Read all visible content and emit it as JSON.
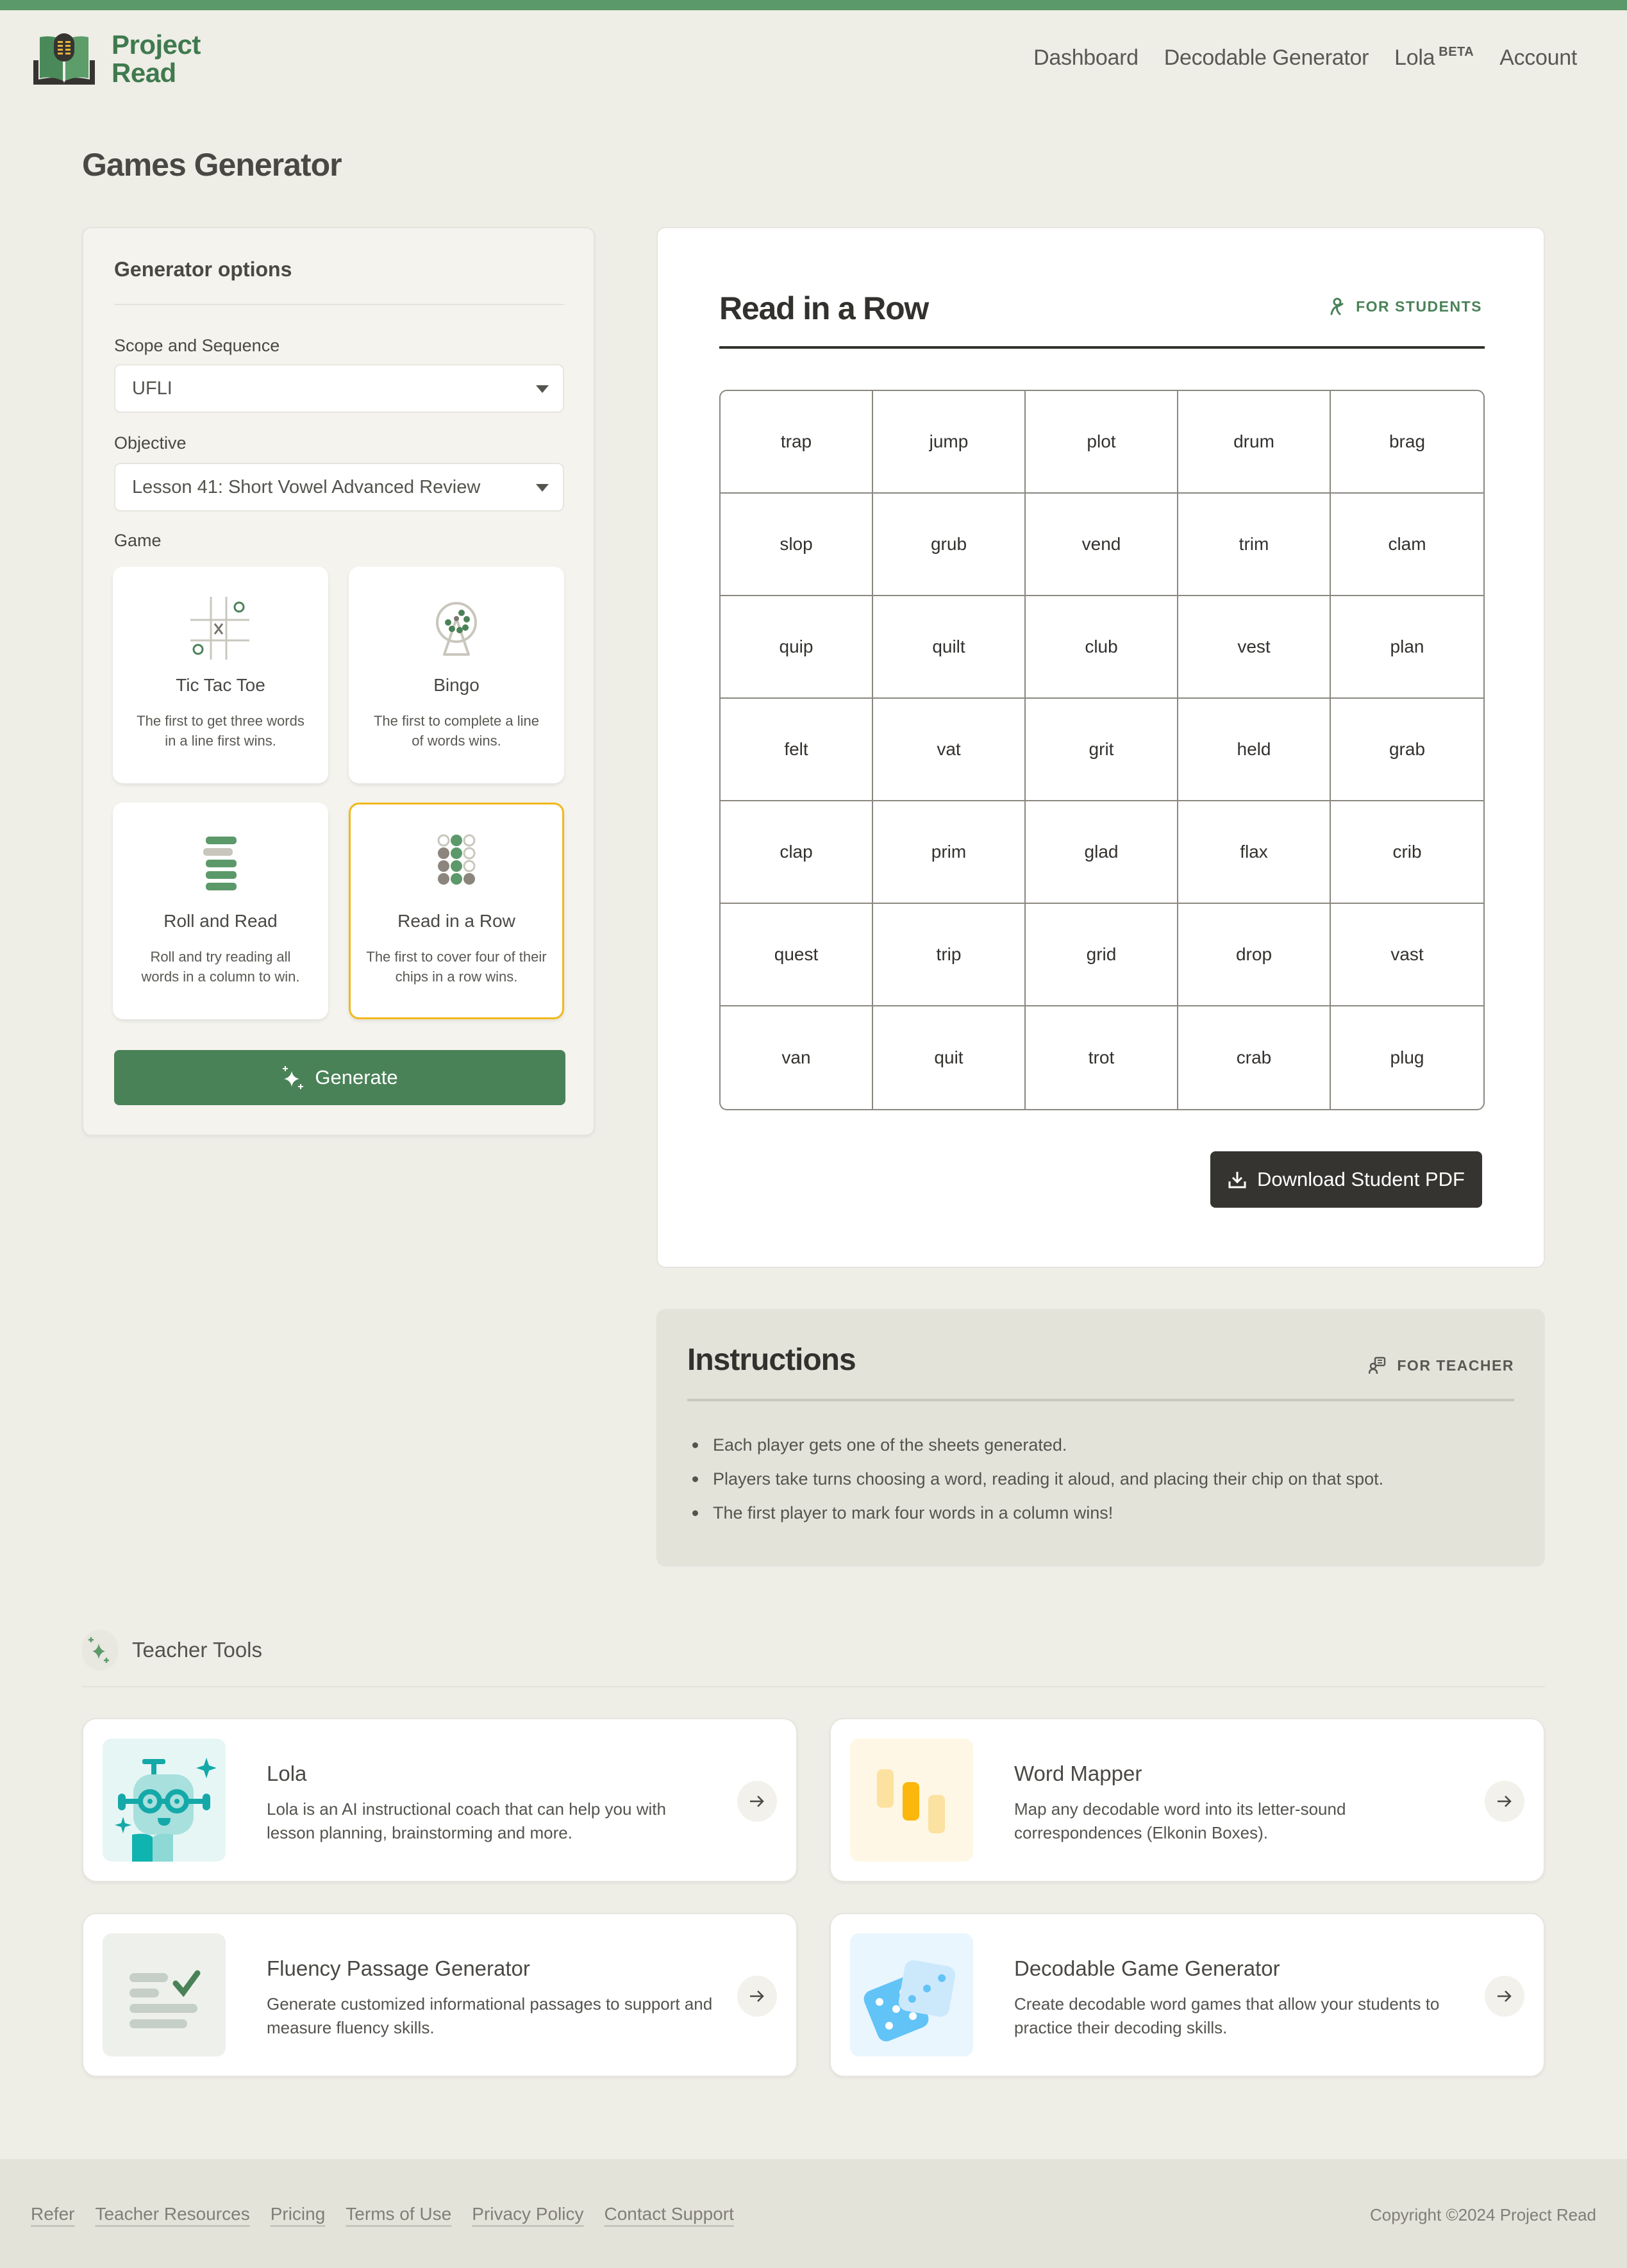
{
  "brand": {
    "name_line1": "Project",
    "name_line2": "Read",
    "accent": "#5c996a",
    "primary_green": "#4a8258",
    "selection_color": "#f2b81c"
  },
  "nav": {
    "items": [
      {
        "label": "Dashboard"
      },
      {
        "label": "Decodable Generator"
      },
      {
        "label": "Lola",
        "badge": "BETA"
      },
      {
        "label": "Account"
      }
    ]
  },
  "page": {
    "title": "Games Generator"
  },
  "generator": {
    "title": "Generator options",
    "scope_label": "Scope and Sequence",
    "scope_value": "UFLI",
    "objective_label": "Objective",
    "objective_value": "Lesson 41: Short Vowel Advanced Review",
    "game_label": "Game",
    "games": [
      {
        "name": "Tic Tac Toe",
        "desc": "The first to get three words in a line first wins.",
        "icon": "tic-tac-toe-icon",
        "selected": false
      },
      {
        "name": "Bingo",
        "desc": "The first to complete a line of words wins.",
        "icon": "bingo-cage-icon",
        "selected": false
      },
      {
        "name": "Roll and Read",
        "desc": "Roll and try reading all words in a column to win.",
        "icon": "stacked-bars-icon",
        "selected": false
      },
      {
        "name": "Read in a Row",
        "desc": "The first to cover four of their chips in a row wins.",
        "icon": "chip-grid-icon",
        "selected": true
      }
    ],
    "generate_label": "Generate"
  },
  "sheet": {
    "title": "Read in a Row",
    "badge": "FOR STUDENTS",
    "rows": [
      [
        "trap",
        "jump",
        "plot",
        "drum",
        "brag"
      ],
      [
        "slop",
        "grub",
        "vend",
        "trim",
        "clam"
      ],
      [
        "quip",
        "quilt",
        "club",
        "vest",
        "plan"
      ],
      [
        "felt",
        "vat",
        "grit",
        "held",
        "grab"
      ],
      [
        "clap",
        "prim",
        "glad",
        "flax",
        "crib"
      ],
      [
        "quest",
        "trip",
        "grid",
        "drop",
        "vast"
      ],
      [
        "van",
        "quit",
        "trot",
        "crab",
        "plug"
      ]
    ],
    "download_label": "Download Student PDF"
  },
  "instructions": {
    "title": "Instructions",
    "badge": "FOR TEACHER",
    "items": [
      "Each player gets one of the sheets generated.",
      "Players take turns choosing a word, reading it aloud, and placing their chip on that spot.",
      "The first player to mark four words in a column wins!"
    ]
  },
  "teacher_tools": {
    "title": "Teacher Tools",
    "tools": [
      {
        "name": "Lola",
        "desc": "Lola is an AI instructional coach that can help you with lesson planning, brainstorming and more."
      },
      {
        "name": "Word Mapper",
        "desc": "Map any decodable word into its letter-sound correspondences (Elkonin Boxes)."
      },
      {
        "name": "Fluency Passage Generator",
        "desc": "Generate customized informational passages to support and measure fluency skills."
      },
      {
        "name": "Decodable Game Generator",
        "desc": "Create decodable word games that allow your students to practice their decoding skills."
      }
    ]
  },
  "footer": {
    "links": [
      "Refer",
      "Teacher Resources",
      "Pricing",
      "Terms of Use",
      "Privacy Policy",
      "Contact Support"
    ],
    "copyright": "Copyright ©2024 Project Read"
  }
}
